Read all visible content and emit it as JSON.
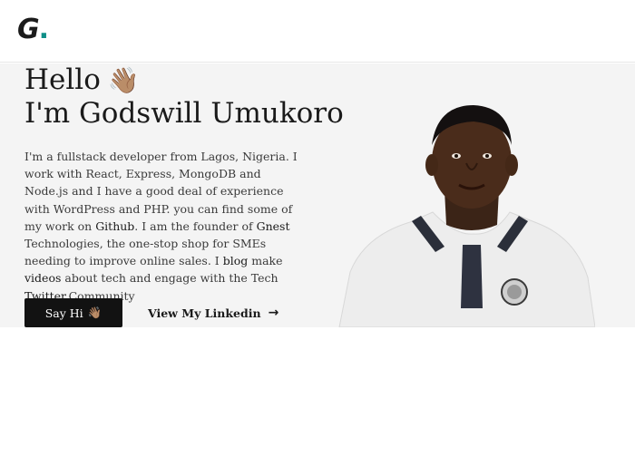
{
  "header": {
    "logo_letter": "G",
    "logo_dot": "."
  },
  "hero": {
    "greeting": "Hello",
    "greeting_emoji": "👋🏽",
    "intro": "I'm Godswill Umukoro",
    "bio": {
      "p1": "I'm a fullstack developer from Lagos, Nigeria. I work with React, Express, MongoDB and Node.js and I have a good deal of experience with WordPress and PHP. you can find some of my work on ",
      "github_link": "Github",
      "p2": ". I am the founder of ",
      "gnest_link": "Gnest",
      "p3": " Technologies, the one-stop shop for SMEs needing to improve online sales. I ",
      "blog_link": "blog",
      "p4": "  make ",
      "videos_link": "videos",
      "p5": " about tech and engage with the Tech ",
      "twitter_link": "Twitter.",
      "p6": "Community"
    },
    "say_hi_label": "Say Hi",
    "say_hi_emoji": "👋🏽",
    "linkedin_label": "View My Linkedin",
    "linkedin_arrow": "→"
  },
  "colors": {
    "hero_bg": "#f4f4f4",
    "button_bg": "#121212",
    "logo_accent": "#0f8f88"
  },
  "icons": {
    "portrait": "person-portrait-image",
    "wave": "waving-hand-icon",
    "arrow": "arrow-right-icon"
  }
}
